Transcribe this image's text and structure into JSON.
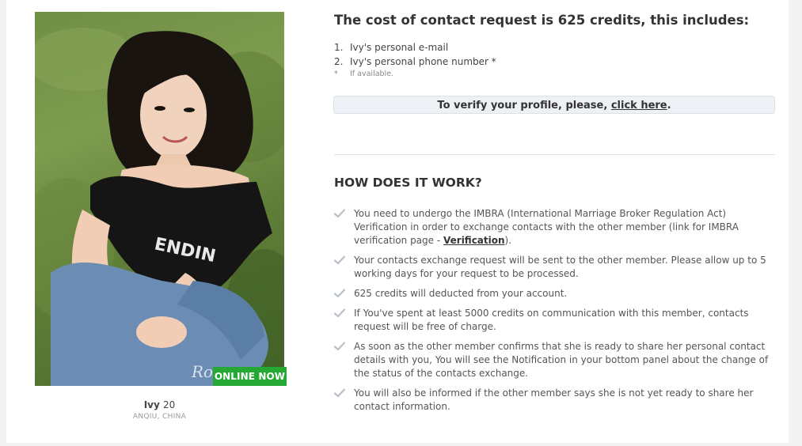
{
  "profile": {
    "name": "Ivy",
    "age": "20",
    "location": "ANQIU, CHINA",
    "online_badge": "ONLINE NOW",
    "photo_watermark": "Ro"
  },
  "contact_request": {
    "title": "The cost of contact request is 625 credits, this includes:",
    "items": [
      {
        "num": "1.",
        "text": "Ivy's personal e-mail"
      },
      {
        "num": "2.",
        "text": "Ivy's personal phone number *"
      }
    ],
    "note_mark": "*",
    "note_text": "If available."
  },
  "verify": {
    "prefix": "To verify your profile, please, ",
    "link": "click here",
    "suffix": "."
  },
  "how": {
    "title": "HOW DOES IT WORK?",
    "step1_before": "You need to undergo the IMBRA (International Marriage Broker Regulation Act) Verification in order to exchange contacts with the other member (link for IMBRA verification page - ",
    "step1_link": "Verification",
    "step1_after": ").",
    "step2": "Your contacts exchange request will be sent to the other member. Please allow up to 5 working days for your request to be processed.",
    "step3": "625 credits will deducted from your account.",
    "step4": "If You've spent at least 5000 credits on communication with this member, contacts request will be free of charge.",
    "step5": "As soon as the other member confirms that she is ready to share her personal contact details with you, You will see the Notification in your bottom panel about the change of the status of the contacts exchange.",
    "step6": "You will also be informed if the other member says she is not yet ready to share her contact information."
  },
  "colors": {
    "online_badge": "#26a834",
    "check": "#b9c0c8",
    "verify_bg": "#edf0f4"
  },
  "icons": {
    "check": "check-icon"
  }
}
